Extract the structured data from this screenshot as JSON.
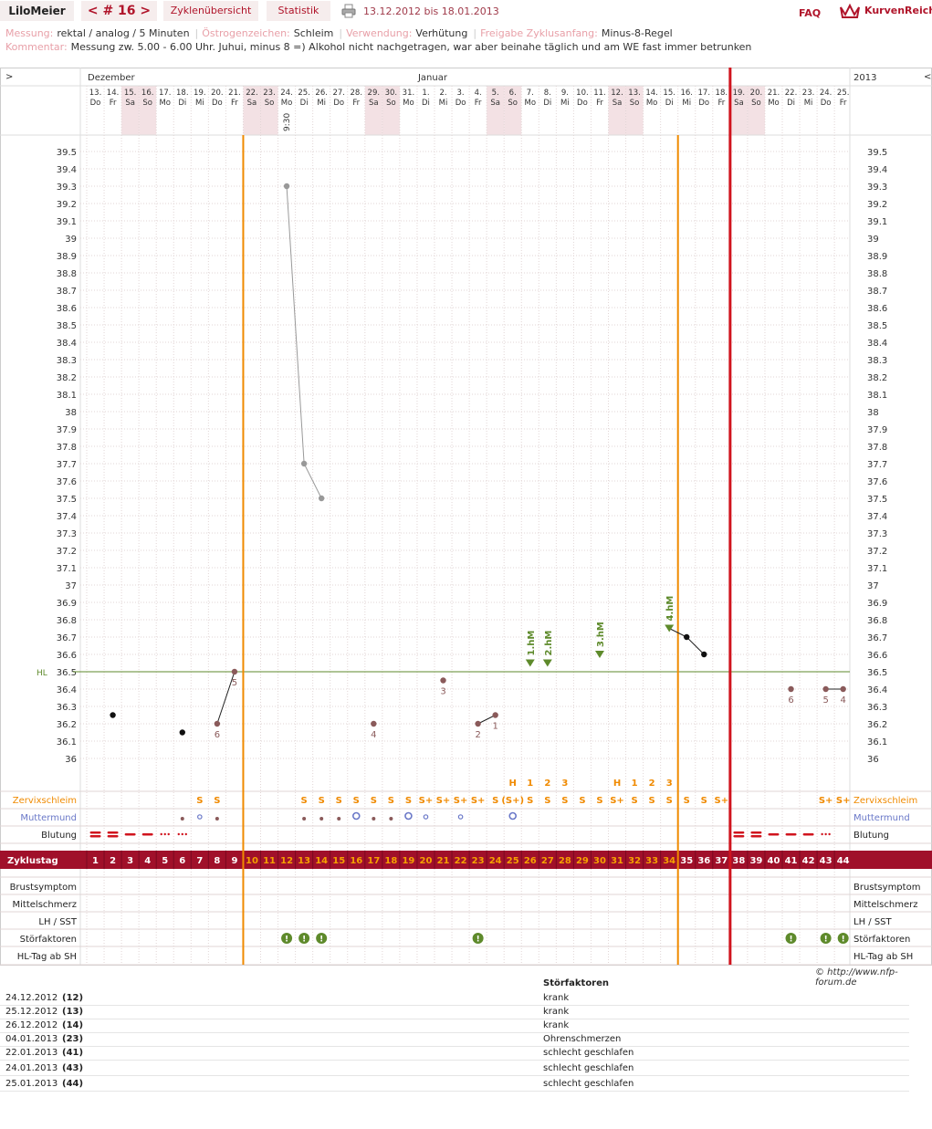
{
  "header": {
    "user": "LiloMeier",
    "cycle_nav": "< # 16 >",
    "tab_cycles": "Zyklenübersicht",
    "tab_stats": "Statistik",
    "date_range": "13.12.2012 bis 18.01.2013",
    "faq": "FAQ",
    "brand": "KurvenReich"
  },
  "meta": {
    "messung_k": "Messung:",
    "messung_v": "rektal / analog / 5 Minuten",
    "oestrogen_k": "Östrogenzeichen:",
    "oestrogen_v": "Schleim",
    "verwendung_k": "Verwendung:",
    "verwendung_v": "Verhütung",
    "freigabe_k": "Freigabe Zyklusanfang:",
    "freigabe_v": "Minus-8-Regel",
    "kommentar_k": "Kommentar:",
    "kommentar_v": "Messung zw. 5.00 - 6.00 Uhr. Juhui, minus 8 =) Alkohol nicht nachgetragen, war aber beinahe täglich und am WE fast immer betrunken"
  },
  "chart_data": {
    "type": "line",
    "month_labels": [
      {
        "index": 0,
        "label": "Dezember"
      },
      {
        "index": 19,
        "label": "Januar"
      }
    ],
    "year_label": "2013",
    "nav_left": ">",
    "nav_right": "<",
    "days": [
      "13.",
      "14.",
      "15.",
      "16.",
      "17.",
      "18.",
      "19.",
      "20.",
      "21.",
      "22.",
      "23.",
      "24.",
      "25.",
      "26.",
      "27.",
      "28.",
      "29.",
      "30.",
      "31.",
      "1.",
      "2.",
      "3.",
      "4.",
      "5.",
      "6.",
      "7.",
      "8.",
      "9.",
      "10.",
      "11.",
      "12.",
      "13.",
      "14.",
      "15.",
      "16.",
      "17.",
      "18.",
      "19.",
      "20.",
      "21.",
      "22.",
      "23.",
      "24.",
      "25."
    ],
    "weekdays": [
      "Do",
      "Fr",
      "Sa",
      "So",
      "Mo",
      "Di",
      "Mi",
      "Do",
      "Fr",
      "Sa",
      "So",
      "Mo",
      "Di",
      "Mi",
      "Do",
      "Fr",
      "Sa",
      "So",
      "Mo",
      "Di",
      "Mi",
      "Do",
      "Fr",
      "Sa",
      "So",
      "Mo",
      "Di",
      "Mi",
      "Do",
      "Fr",
      "Sa",
      "So",
      "Mo",
      "Di",
      "Mi",
      "Do",
      "Fr",
      "Sa",
      "So",
      "Mo",
      "Di",
      "Mi",
      "Do",
      "Fr"
    ],
    "weekend_indices": [
      2,
      3,
      9,
      10,
      16,
      17,
      23,
      24,
      30,
      31,
      37,
      38
    ],
    "time_note": {
      "day": 12,
      "text": "9:30"
    },
    "ylim": [
      36.0,
      39.5
    ],
    "yticks": [
      "39.5",
      "39.4",
      "39.3",
      "39.2",
      "39.1",
      "39",
      "38.9",
      "38.8",
      "38.7",
      "38.6",
      "38.5",
      "38.4",
      "38.3",
      "38.2",
      "38.1",
      "38",
      "37.9",
      "37.8",
      "37.7",
      "37.6",
      "37.5",
      "37.4",
      "37.3",
      "37.2",
      "37.1",
      "37",
      "36.9",
      "36.8",
      "36.7",
      "36.6",
      "36.5",
      "36.4",
      "36.3",
      "36.2",
      "36.1",
      "36"
    ],
    "hl_label": "HL",
    "hl_value": 36.5,
    "temperatures": [
      {
        "day": 2,
        "value": 36.25,
        "style": "black"
      },
      {
        "day": 6,
        "value": 36.15,
        "style": "black"
      },
      {
        "day": 8,
        "value": 36.2,
        "style": "brown",
        "label": "6"
      },
      {
        "day": 9,
        "value": 36.5,
        "style": "brown",
        "label": "5"
      },
      {
        "day": 12,
        "value": 39.3,
        "style": "grey"
      },
      {
        "day": 13,
        "value": 37.7,
        "style": "grey"
      },
      {
        "day": 14,
        "value": 37.5,
        "style": "grey"
      },
      {
        "day": 17,
        "value": 36.2,
        "style": "brown",
        "label": "4"
      },
      {
        "day": 21,
        "value": 36.45,
        "style": "brown",
        "label": "3"
      },
      {
        "day": 23,
        "value": 36.2,
        "style": "brown",
        "label": "2"
      },
      {
        "day": 24,
        "value": 36.25,
        "style": "brown",
        "label": "1"
      },
      {
        "day": 26,
        "value": 36.55,
        "style": "green",
        "label": "1.hM"
      },
      {
        "day": 27,
        "value": 36.55,
        "style": "green",
        "label": "2.hM"
      },
      {
        "day": 30,
        "value": 36.6,
        "style": "green",
        "label": "3.hM"
      },
      {
        "day": 34,
        "value": 36.75,
        "style": "green",
        "label": "4.hM"
      },
      {
        "day": 35,
        "value": 36.7,
        "style": "black"
      },
      {
        "day": 36,
        "value": 36.6,
        "style": "black"
      },
      {
        "day": 41,
        "value": 36.4,
        "style": "brown",
        "label": "6"
      },
      {
        "day": 43,
        "value": 36.4,
        "style": "brown",
        "label": "5"
      },
      {
        "day": 44,
        "value": 36.4,
        "style": "brown",
        "label": "4"
      }
    ],
    "lines": [
      [
        8,
        9
      ],
      [
        12,
        13
      ],
      [
        13,
        14
      ],
      [
        23,
        24
      ],
      [
        34,
        35
      ],
      [
        35,
        36
      ],
      [
        43,
        44
      ]
    ],
    "ovulation_lines": [
      9,
      34
    ],
    "cycle_end": 37,
    "peak_labels": [
      {
        "day": 25,
        "text": "H"
      },
      {
        "day": 26,
        "text": "1"
      },
      {
        "day": 27,
        "text": "2"
      },
      {
        "day": 28,
        "text": "3"
      },
      {
        "day": 31,
        "text": "H"
      },
      {
        "day": 32,
        "text": "1"
      },
      {
        "day": 33,
        "text": "2"
      },
      {
        "day": 34,
        "text": "3"
      }
    ],
    "rows": {
      "zervix": "Zervixschleim",
      "muttermund": "Muttermund",
      "blutung": "Blutung",
      "zyklustag": "Zyklustag",
      "brust": "Brustsymptom",
      "mittel": "Mittelschmerz",
      "lh": "LH / SST",
      "stoer": "Störfaktoren",
      "hltag": "HL-Tag ab SH"
    },
    "zervix": [
      {
        "day": 7,
        "t": "S"
      },
      {
        "day": 8,
        "t": "S"
      },
      {
        "day": 13,
        "t": "S"
      },
      {
        "day": 14,
        "t": "S"
      },
      {
        "day": 15,
        "t": "S"
      },
      {
        "day": 16,
        "t": "S"
      },
      {
        "day": 17,
        "t": "S"
      },
      {
        "day": 18,
        "t": "S"
      },
      {
        "day": 19,
        "t": "S"
      },
      {
        "day": 20,
        "t": "S+"
      },
      {
        "day": 21,
        "t": "S+"
      },
      {
        "day": 22,
        "t": "S+"
      },
      {
        "day": 23,
        "t": "S+"
      },
      {
        "day": 24,
        "t": "S"
      },
      {
        "day": 25,
        "t": "(S+)"
      },
      {
        "day": 26,
        "t": "S"
      },
      {
        "day": 27,
        "t": "S"
      },
      {
        "day": 28,
        "t": "S"
      },
      {
        "day": 29,
        "t": "S"
      },
      {
        "day": 30,
        "t": "S"
      },
      {
        "day": 31,
        "t": "S+"
      },
      {
        "day": 32,
        "t": "S"
      },
      {
        "day": 33,
        "t": "S"
      },
      {
        "day": 34,
        "t": "S"
      },
      {
        "day": 35,
        "t": "S"
      },
      {
        "day": 36,
        "t": "S"
      },
      {
        "day": 37,
        "t": "S+"
      },
      {
        "day": 43,
        "t": "S+"
      },
      {
        "day": 44,
        "t": "S+"
      }
    ],
    "muttermund": [
      {
        "day": 6,
        "t": "low"
      },
      {
        "day": 7,
        "t": "mid"
      },
      {
        "day": 8,
        "t": "low"
      },
      {
        "day": 13,
        "t": "low"
      },
      {
        "day": 14,
        "t": "low"
      },
      {
        "day": 15,
        "t": "low"
      },
      {
        "day": 16,
        "t": "open"
      },
      {
        "day": 17,
        "t": "low"
      },
      {
        "day": 18,
        "t": "low"
      },
      {
        "day": 19,
        "t": "open"
      },
      {
        "day": 20,
        "t": "mid"
      },
      {
        "day": 22,
        "t": "mid"
      },
      {
        "day": 25,
        "t": "open"
      }
    ],
    "blutung": [
      {
        "day": 1,
        "t": "heavy"
      },
      {
        "day": 2,
        "t": "heavy"
      },
      {
        "day": 3,
        "t": "medium"
      },
      {
        "day": 4,
        "t": "medium"
      },
      {
        "day": 5,
        "t": "spot"
      },
      {
        "day": 6,
        "t": "spot"
      },
      {
        "day": 38,
        "t": "heavy"
      },
      {
        "day": 39,
        "t": "heavy"
      },
      {
        "day": 40,
        "t": "medium"
      },
      {
        "day": 41,
        "t": "medium"
      },
      {
        "day": 42,
        "t": "medium"
      },
      {
        "day": 43,
        "t": "spot"
      }
    ],
    "cycle_days": [
      "1",
      "2",
      "3",
      "4",
      "5",
      "6",
      "7",
      "8",
      "9",
      "10",
      "11",
      "12",
      "13",
      "14",
      "15",
      "16",
      "17",
      "18",
      "19",
      "20",
      "21",
      "22",
      "23",
      "24",
      "25",
      "26",
      "27",
      "28",
      "29",
      "30",
      "31",
      "32",
      "33",
      "34",
      "35",
      "36",
      "37",
      "38",
      "39",
      "40",
      "41",
      "42",
      "43",
      "44"
    ],
    "stoer_days": [
      12,
      13,
      14,
      23,
      41,
      43,
      44
    ]
  },
  "credit": "© http://www.nfp-forum.de",
  "stoerfaktoren": {
    "title": "Störfaktoren",
    "rows": [
      {
        "date": "24.12.2012",
        "cd": "(12)",
        "text": "krank"
      },
      {
        "date": "25.12.2012",
        "cd": "(13)",
        "text": "krank"
      },
      {
        "date": "26.12.2012",
        "cd": "(14)",
        "text": "krank"
      },
      {
        "date": "04.01.2013",
        "cd": "(23)",
        "text": "Ohrenschmerzen"
      },
      {
        "date": "22.01.2013",
        "cd": "(41)",
        "text": "schlecht geschlafen"
      },
      {
        "date": "24.01.2013",
        "cd": "(43)",
        "text": "schlecht geschlafen"
      },
      {
        "date": "25.01.2013",
        "cd": "(44)",
        "text": "schlecht geschlafen"
      }
    ]
  },
  "colors": {
    "brand": "#b0142a",
    "orange": "#f08a00",
    "green": "#5e8a2b",
    "blue": "#6a78c8",
    "brown": "#8a5a5a",
    "weekend": "#f3e1e4",
    "grid": "#e2d6d6"
  }
}
